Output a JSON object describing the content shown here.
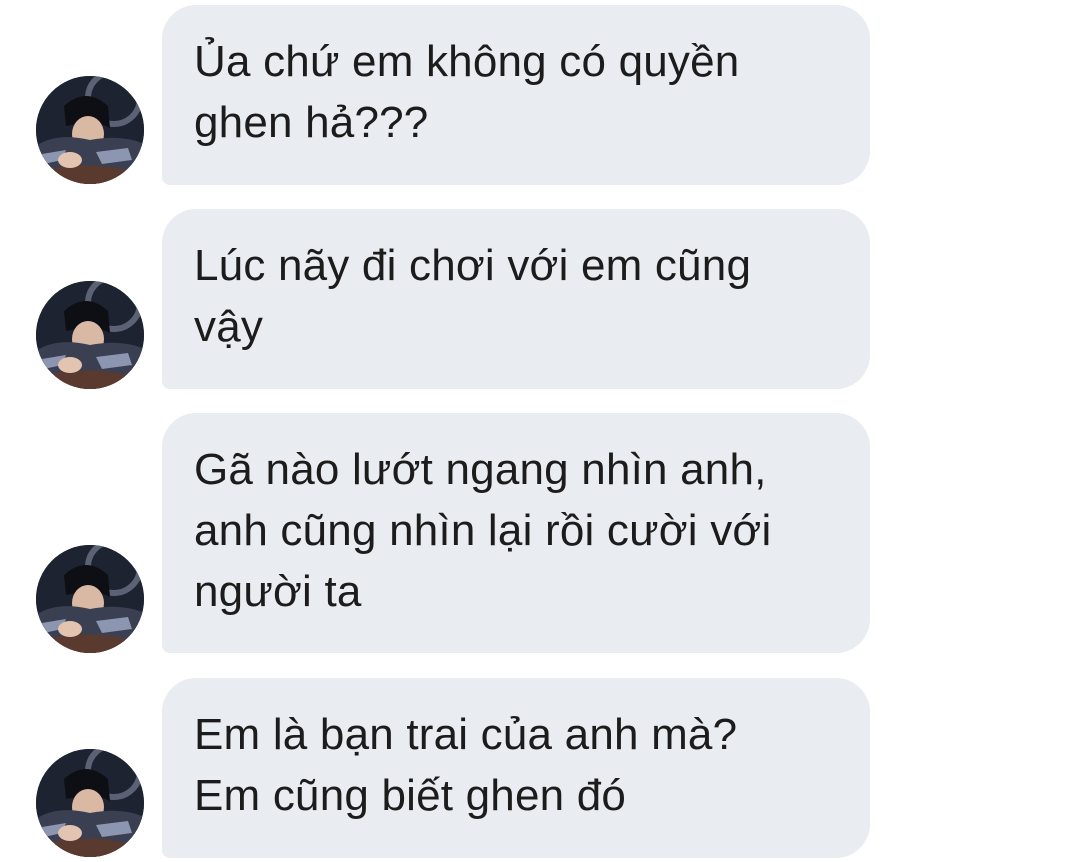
{
  "conversation": {
    "messages": [
      {
        "avatar_icon": "user-avatar-photo",
        "lines": [
          "Ủa chứ em không có quyền",
          "ghen hả???"
        ]
      },
      {
        "avatar_icon": "user-avatar-photo",
        "lines": [
          "Lúc nãy đi chơi với em cũng",
          "vậy"
        ]
      },
      {
        "avatar_icon": "user-avatar-photo",
        "lines": [
          "Gã nào lướt ngang nhìn anh,",
          "anh cũng nhìn lại rồi cười với",
          "người ta"
        ]
      },
      {
        "avatar_icon": "user-avatar-photo",
        "lines": [
          "Em là bạn trai của anh mà?",
          "Em cũng biết ghen đó"
        ]
      }
    ]
  },
  "colors": {
    "bubble_background": "#e9ecf0",
    "text": "#1c1c1c",
    "page_background": "#ffffff"
  }
}
